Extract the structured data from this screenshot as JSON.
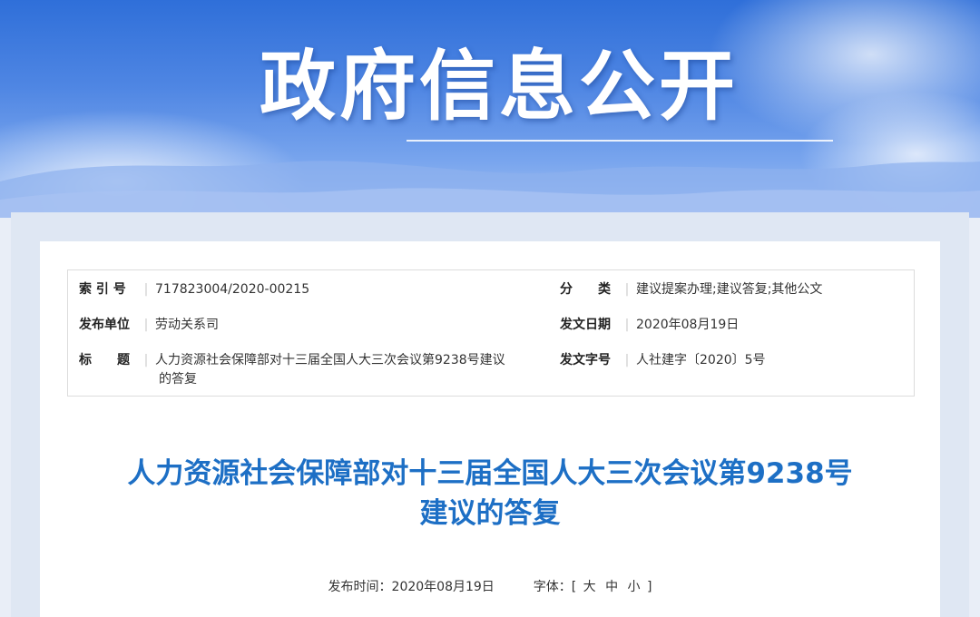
{
  "banner": {
    "title": "政府信息公开"
  },
  "meta": {
    "index_label": "索 引 号",
    "index_value": "717823004/2020-00215",
    "category_label": "分　　类",
    "category_value": "建议提案办理;建议答复;其他公文",
    "unit_label": "发布单位",
    "unit_value": "劳动关系司",
    "date_label": "发文日期",
    "date_value": "2020年08月19日",
    "subject_label": "标　　题",
    "subject_value_line1": "人力资源社会保障部对十三届全国人大三次会议第9238号建议",
    "subject_value_line2": "的答复",
    "docno_label": "发文字号",
    "docno_value": "人社建字〔2020〕5号"
  },
  "doc": {
    "title_line1": "人力资源社会保障部对十三届全国人大三次会议第9238号",
    "title_line2": "建议的答复"
  },
  "pubbar": {
    "time_label": "发布时间：",
    "time_value": "2020年08月19日",
    "font_label": "字体：",
    "bracket_open": "[",
    "size_large": "大",
    "size_medium": "中",
    "size_small": "小",
    "bracket_close": "]"
  }
}
